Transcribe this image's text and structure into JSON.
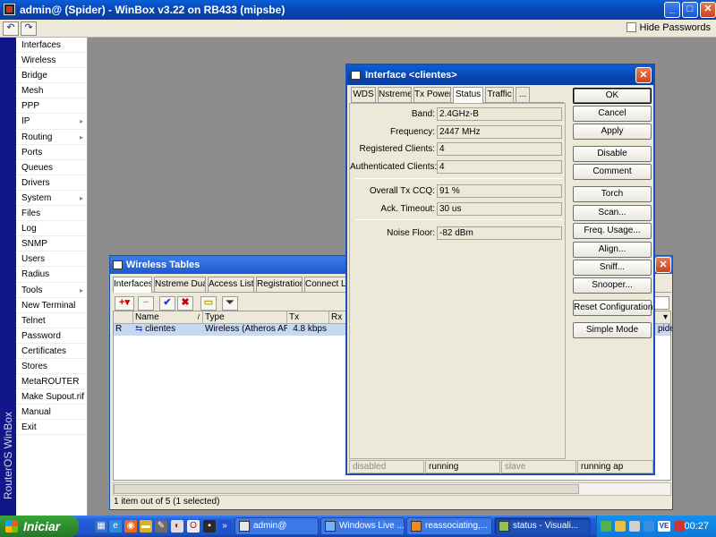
{
  "window": {
    "title": "admin@                   (Spider) - WinBox v3.22 on RB433 (mipsbe)",
    "hide_passwords_label": "Hide Passwords",
    "brand_vertical": "RouterOS WinBox",
    "undo_icon": "undo-icon",
    "redo_icon": "redo-icon"
  },
  "menu": [
    {
      "label": "Interfaces",
      "submenu": false
    },
    {
      "label": "Wireless",
      "submenu": false
    },
    {
      "label": "Bridge",
      "submenu": false
    },
    {
      "label": "Mesh",
      "submenu": false
    },
    {
      "label": "PPP",
      "submenu": false
    },
    {
      "label": "IP",
      "submenu": true
    },
    {
      "label": "Routing",
      "submenu": true
    },
    {
      "label": "Ports",
      "submenu": false
    },
    {
      "label": "Queues",
      "submenu": false
    },
    {
      "label": "Drivers",
      "submenu": false
    },
    {
      "label": "System",
      "submenu": true
    },
    {
      "label": "Files",
      "submenu": false
    },
    {
      "label": "Log",
      "submenu": false
    },
    {
      "label": "SNMP",
      "submenu": false
    },
    {
      "label": "Users",
      "submenu": false
    },
    {
      "label": "Radius",
      "submenu": false
    },
    {
      "label": "Tools",
      "submenu": true
    },
    {
      "label": "New Terminal",
      "submenu": false
    },
    {
      "label": "Telnet",
      "submenu": false
    },
    {
      "label": "Password",
      "submenu": false
    },
    {
      "label": "Certificates",
      "submenu": false
    },
    {
      "label": "Stores",
      "submenu": false
    },
    {
      "label": "MetaROUTER",
      "submenu": false
    },
    {
      "label": "Make Supout.rif",
      "submenu": false
    },
    {
      "label": "Manual",
      "submenu": false
    },
    {
      "label": "Exit",
      "submenu": false
    }
  ],
  "wireless_tables": {
    "title": "Wireless Tables",
    "tabs": [
      "Interfaces",
      "Nstreme Dual",
      "Access List",
      "Registration",
      "Connect List"
    ],
    "active_tab": "Interfaces",
    "columns": [
      "",
      "Name",
      "Type",
      "Tx",
      "Rx"
    ],
    "rows": [
      {
        "flag": "R",
        "name": "clientes",
        "type": "Wireless (Atheros AR5...",
        "tx": "4.8 kbps",
        "rx": "46."
      }
    ],
    "partial_right_text": "pide",
    "status": "1 item out of 5 (1 selected)"
  },
  "dialog": {
    "title": "Interface <clientes>",
    "tabs": [
      "WDS",
      "Nstreme",
      "Tx Power",
      "Status",
      "Traffic",
      "..."
    ],
    "active_tab": "Status",
    "fields": {
      "band": {
        "label": "Band:",
        "value": "2.4GHz-B"
      },
      "frequency": {
        "label": "Frequency:",
        "value": "2447 MHz"
      },
      "registered_clients": {
        "label": "Registered Clients:",
        "value": "4"
      },
      "authenticated_clients": {
        "label": "Authenticated Clients:",
        "value": "4"
      },
      "overall_tx_ccq": {
        "label": "Overall Tx CCQ:",
        "value": "91 %"
      },
      "ack_timeout": {
        "label": "Ack. Timeout:",
        "value": "30 us"
      },
      "noise_floor": {
        "label": "Noise Floor:",
        "value": "-82 dBm"
      }
    },
    "buttons": [
      "OK",
      "Cancel",
      "Apply",
      "Disable",
      "Comment",
      "Torch",
      "Scan...",
      "Freq. Usage...",
      "Align...",
      "Sniff...",
      "Snooper...",
      "Reset Configuration",
      "Simple Mode"
    ],
    "statusbar": [
      "disabled",
      "running",
      "slave",
      "running ap"
    ]
  },
  "taskbar": {
    "start_label": "Iniciar",
    "items": [
      {
        "label": "admin@",
        "active": false
      },
      {
        "label": "Windows Live ...",
        "active": false
      },
      {
        "label": "reassociating,...",
        "active": false
      },
      {
        "label": "status - Visuali...",
        "active": true
      }
    ],
    "clock": "00:27",
    "tray_lang": "VE"
  },
  "colors": {
    "title_blue": "#0a4fd0",
    "menu_bar_navy": "#11168a",
    "taskbar_blue": "#245edb",
    "start_green": "#2e8d2e",
    "selection": "#c8d8f0"
  }
}
